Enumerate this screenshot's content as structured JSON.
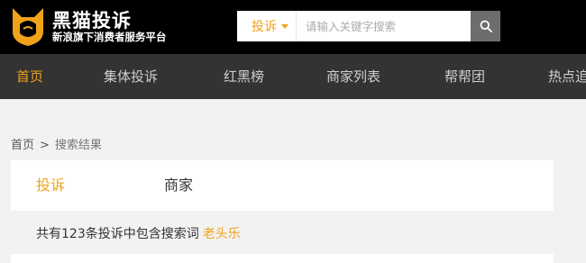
{
  "header": {
    "brand_title": "黑猫投诉",
    "brand_subtitle": "新浪旗下消费者服务平台",
    "logo_icon": "black-cat-logo-icon",
    "accent_color": "#f0a21b"
  },
  "search": {
    "type_label": "投诉",
    "placeholder": "请输入关键字搜索",
    "value": "",
    "button_icon": "search-icon"
  },
  "nav": {
    "items": [
      {
        "label": "首页",
        "active": true
      },
      {
        "label": "集体投诉",
        "active": false
      },
      {
        "label": "红黑榜",
        "active": false
      },
      {
        "label": "商家列表",
        "active": false
      },
      {
        "label": "帮帮团",
        "active": false
      },
      {
        "label": "热点追",
        "active": false
      }
    ]
  },
  "breadcrumb": {
    "home": "首页",
    "separator": ">",
    "current": "搜索结果"
  },
  "result_tabs": {
    "items": [
      {
        "label": "投诉",
        "active": true
      },
      {
        "label": "商家",
        "active": false
      }
    ]
  },
  "results": {
    "summary_text": "共有123条投诉中包含搜索词",
    "keyword": "老头乐"
  }
}
